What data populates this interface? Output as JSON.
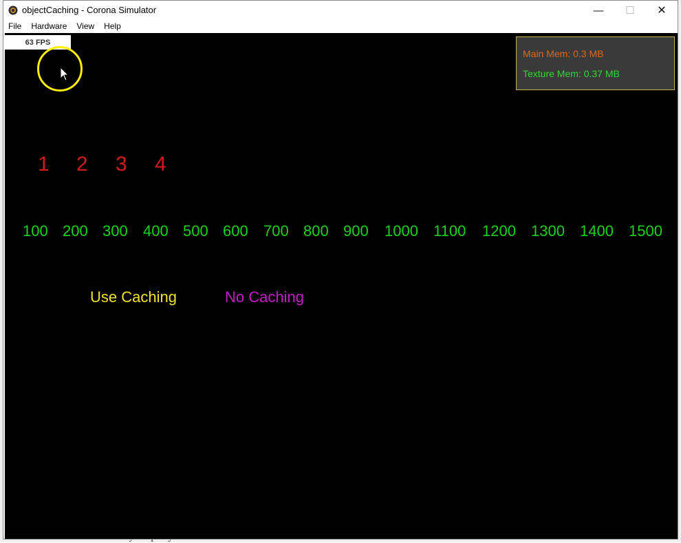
{
  "window": {
    "title": "objectCaching - Corona Simulator",
    "controls": [
      "—",
      "☐",
      "✕"
    ]
  },
  "menu": [
    "File",
    "Hardware",
    "View",
    "Help"
  ],
  "fps": "63 FPS",
  "memory": {
    "main": "Main Mem: 0.3 MB",
    "texture": "Texture Mem: 0.37 MB"
  },
  "small_numbers": [
    "1",
    "2",
    "3",
    "4"
  ],
  "counts": [
    "100",
    "200",
    "300",
    "400",
    "500",
    "600",
    "700",
    "800",
    "900",
    "1000",
    "1100",
    "1200",
    "1300",
    "1400",
    "1500"
  ],
  "buttons": {
    "use_caching": "Use Caching",
    "no_caching": "No Caching"
  },
  "background_text": "Monkey not pinky",
  "colors": {
    "red": "#d41b1b",
    "green": "#1fd11f",
    "yellow": "#f2e22b",
    "magenta": "#c51cc8",
    "main_mem": "#e2661a",
    "texture_mem": "#35d635"
  }
}
